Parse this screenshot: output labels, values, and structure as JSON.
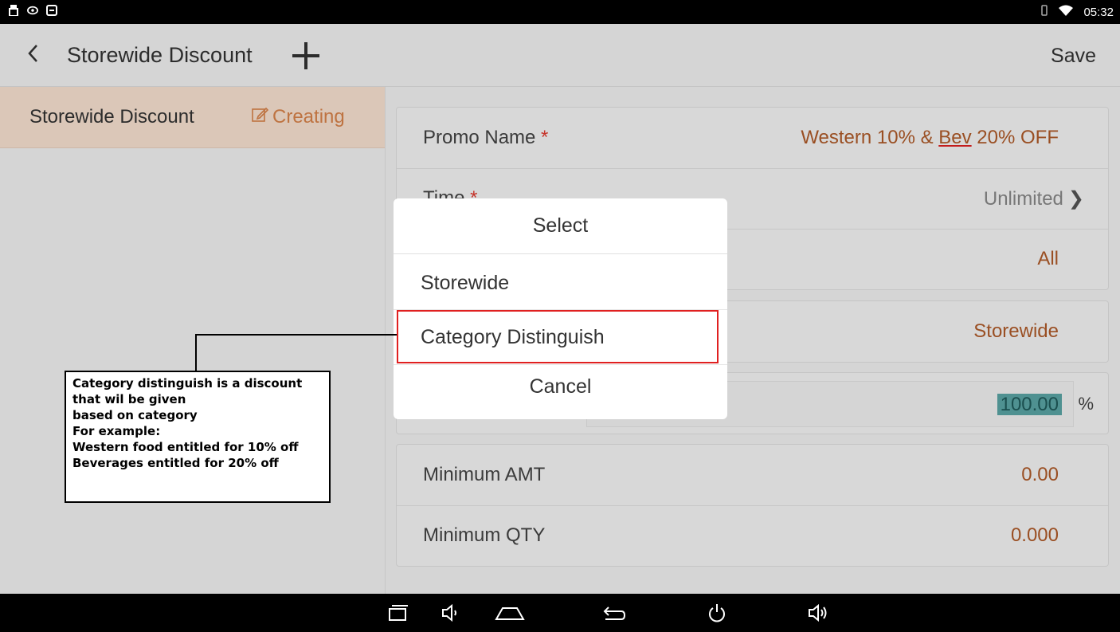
{
  "status_bar": {
    "time": "05:32",
    "left_icons": [
      "usb-icon",
      "eye-icon",
      "screen-icon"
    ],
    "right_icons": [
      "vibrate-icon",
      "wifi-icon"
    ]
  },
  "app_bar": {
    "title": "Storewide Discount",
    "save_label": "Save"
  },
  "sidebar": {
    "items": [
      {
        "label": "Storewide Discount",
        "status": "Creating"
      }
    ]
  },
  "form": {
    "promo_name": {
      "label": "Promo Name",
      "required": "*",
      "value_prefix": "Western 10% & ",
      "value_underlined": "Bev",
      "value_suffix": " 20% OFF"
    },
    "time": {
      "label": "Time",
      "required": "*",
      "value": "Unlimited"
    },
    "row3": {
      "value": "All"
    },
    "row4": {
      "value": "Storewide"
    },
    "discount": {
      "value": "100.00",
      "unit": "%"
    },
    "minimum_amt": {
      "label": "Minimum AMT",
      "value": "0.00"
    },
    "minimum_qty": {
      "label": "Minimum QTY",
      "value": "0.000"
    }
  },
  "dialog": {
    "title": "Select",
    "options": [
      "Storewide",
      "Category Distinguish"
    ],
    "cancel": "Cancel"
  },
  "annotation": {
    "lines": [
      "Category distinguish is a discount",
      "that wil be given",
      "based on category",
      "For example:",
      "Western food entitled for 10% off",
      "Beverages entitled for 20% off"
    ]
  },
  "colors": {
    "accent": "#b05a28",
    "selected_bg": "#fae3d2",
    "highlight": "#e02020"
  }
}
